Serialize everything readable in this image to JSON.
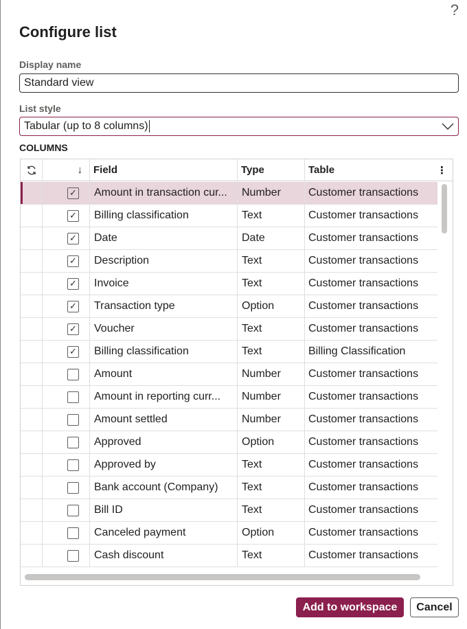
{
  "dialog": {
    "help_glyph": "?",
    "title": "Configure list"
  },
  "display_name": {
    "label": "Display name",
    "value": "Standard view"
  },
  "list_style": {
    "label": "List style",
    "value": "Tabular (up to 8 columns)"
  },
  "columns_section": {
    "title": "COLUMNS",
    "headers": {
      "refresh_icon": "refresh-icon",
      "sort_glyph": "↓",
      "field": "Field",
      "type": "Type",
      "table": "Table",
      "more_glyph": "⋮"
    },
    "rows": [
      {
        "checked": true,
        "field": "Amount in transaction cur...",
        "type": "Number",
        "table": "Customer transactions",
        "selected": true
      },
      {
        "checked": true,
        "field": "Billing classification",
        "type": "Text",
        "table": "Customer transactions"
      },
      {
        "checked": true,
        "field": "Date",
        "type": "Date",
        "table": "Customer transactions"
      },
      {
        "checked": true,
        "field": "Description",
        "type": "Text",
        "table": "Customer transactions"
      },
      {
        "checked": true,
        "field": "Invoice",
        "type": "Text",
        "table": "Customer transactions"
      },
      {
        "checked": true,
        "field": "Transaction type",
        "type": "Option",
        "table": "Customer transactions"
      },
      {
        "checked": true,
        "field": "Voucher",
        "type": "Text",
        "table": "Customer transactions"
      },
      {
        "checked": true,
        "field": "Billing classification",
        "type": "Text",
        "table": "Billing Classification"
      },
      {
        "checked": false,
        "field": "Amount",
        "type": "Number",
        "table": "Customer transactions"
      },
      {
        "checked": false,
        "field": "Amount in reporting curr...",
        "type": "Number",
        "table": "Customer transactions"
      },
      {
        "checked": false,
        "field": "Amount settled",
        "type": "Number",
        "table": "Customer transactions"
      },
      {
        "checked": false,
        "field": "Approved",
        "type": "Option",
        "table": "Customer transactions"
      },
      {
        "checked": false,
        "field": "Approved by",
        "type": "Text",
        "table": "Customer transactions"
      },
      {
        "checked": false,
        "field": "Bank account (Company)",
        "type": "Text",
        "table": "Customer transactions"
      },
      {
        "checked": false,
        "field": "Bill ID",
        "type": "Text",
        "table": "Customer transactions"
      },
      {
        "checked": false,
        "field": "Canceled payment",
        "type": "Option",
        "table": "Customer transactions"
      },
      {
        "checked": false,
        "field": "Cash discount",
        "type": "Text",
        "table": "Customer transactions"
      }
    ]
  },
  "buttons": {
    "add": "Add to workspace",
    "cancel": "Cancel"
  },
  "colors": {
    "accent": "#8b1f4d",
    "selected_row": "#e9d5dc"
  }
}
